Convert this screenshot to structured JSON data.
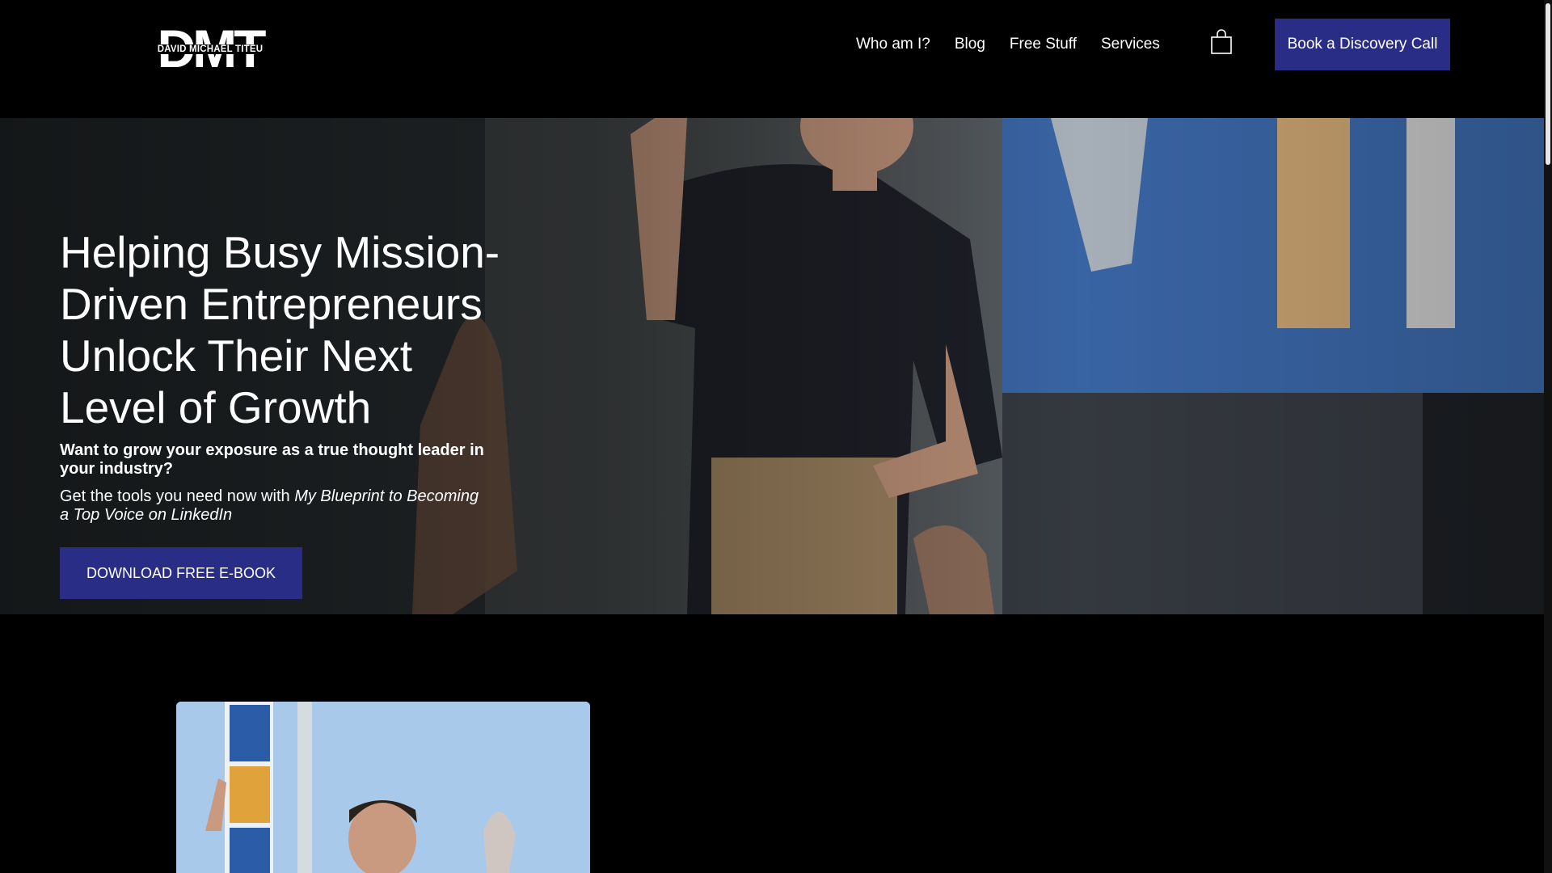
{
  "header": {
    "logo_letters": "DMT",
    "logo_name": "DAVID MICHAEL TITEU",
    "nav": [
      "Who am I?",
      "Blog",
      "Free Stuff",
      "Services"
    ],
    "cart_icon": "shopping-bag-icon",
    "cta_label": "Book a Discovery Call"
  },
  "hero": {
    "title": "Helping Busy Mission-Driven Entrepreneurs Unlock Their Next Level of Growth",
    "subtitle": "Want to grow your exposure as a true thought leader in your industry?",
    "text_prefix": "Get the tools you need now with ",
    "text_italic": "My Blueprint to Becoming a Top Voice on LinkedIn",
    "cta_label": "DOWNLOAD FREE E-BOOK"
  },
  "colors": {
    "background": "#000000",
    "accent": "#2a2d86",
    "text": "#ffffff"
  }
}
